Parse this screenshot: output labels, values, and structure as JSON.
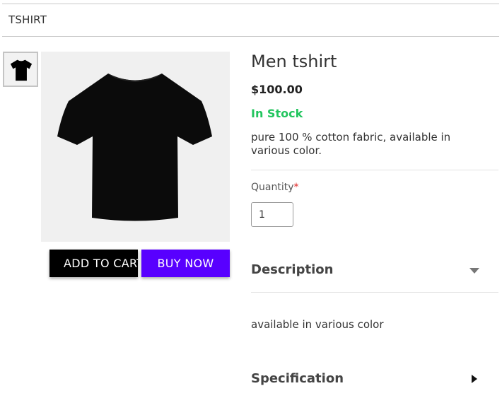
{
  "breadcrumb": {
    "title": "TSHIRT"
  },
  "product": {
    "name": "Men tshirt",
    "price": "$100.00",
    "stock_status": "In Stock",
    "short_description": "pure 100 % cotton fabric, available in various color.",
    "image_icon": "tshirt-image",
    "thumbnail_icon": "tshirt-thumbnail"
  },
  "quantity": {
    "label": "Quantity",
    "required_mark": "*",
    "value": "1"
  },
  "actions": {
    "add_to_cart_label": "ADD TO CART",
    "buy_now_label": "BUY NOW"
  },
  "accordion": {
    "description": {
      "title": "Description",
      "body": "available in various color",
      "expanded": true,
      "icon": "caret-down-icon"
    },
    "specification": {
      "title": "Specification",
      "expanded": false,
      "icon": "caret-right-icon"
    }
  },
  "colors": {
    "stock_green": "#22c55e",
    "buy_now_bg": "#5800ff",
    "add_to_cart_bg": "#000000",
    "required_red": "#e02424"
  }
}
